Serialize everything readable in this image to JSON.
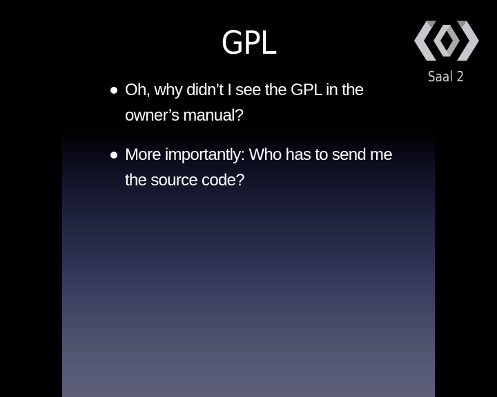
{
  "slide": {
    "title": "GPL",
    "bullets": [
      "Oh, why didn’t I see the GPL in the owner’s manual?",
      "More importantly: Who has to send me the source code?"
    ]
  },
  "overlay": {
    "logo_icon": "congress-logo-icon",
    "room_label": "Saal 2"
  },
  "colors": {
    "background": "#000000",
    "gradient_bottom": "#5d6078",
    "text": "#ffffff",
    "logo": "#c8c8cc"
  }
}
